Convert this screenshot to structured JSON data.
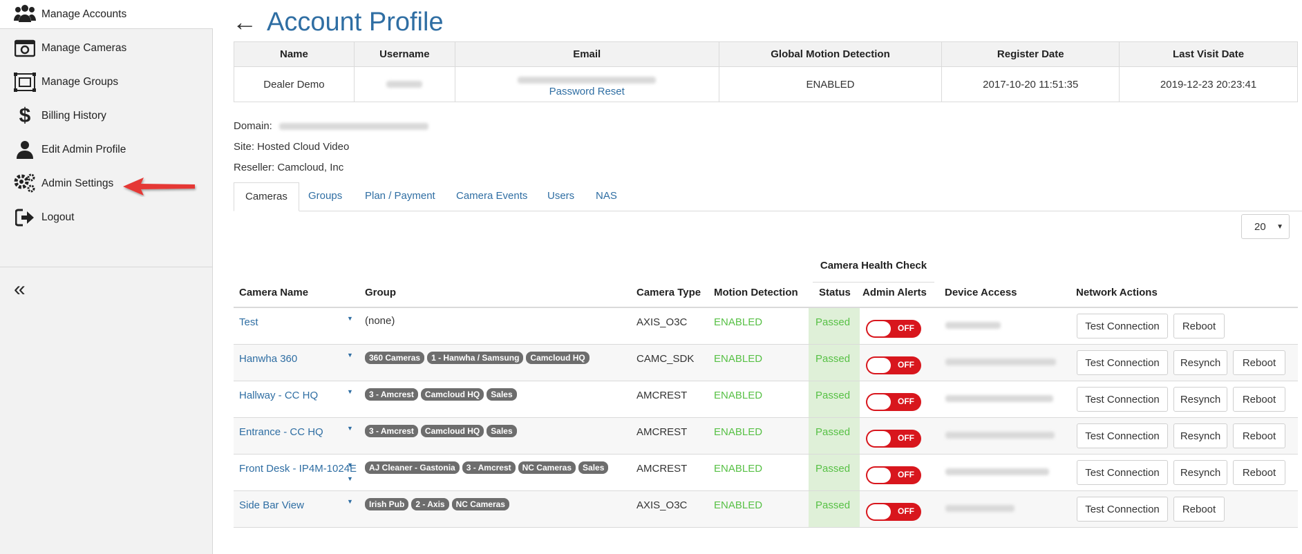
{
  "sidebar": {
    "items": [
      {
        "label": "Manage Accounts",
        "icon": "users-icon"
      },
      {
        "label": "Manage Cameras",
        "icon": "camera-icon"
      },
      {
        "label": "Manage Groups",
        "icon": "groups-icon"
      },
      {
        "label": "Billing History",
        "icon": "dollar-icon"
      },
      {
        "label": "Edit Admin Profile",
        "icon": "user-icon"
      },
      {
        "label": "Admin Settings",
        "icon": "gears-icon"
      },
      {
        "label": "Logout",
        "icon": "logout-icon"
      }
    ],
    "collapse_glyph": "«"
  },
  "page": {
    "back_glyph": "←",
    "title": "Account Profile"
  },
  "account": {
    "headers": [
      "Name",
      "Username",
      "Email",
      "Global Motion Detection",
      "Register Date",
      "Last Visit Date"
    ],
    "name": "Dealer Demo",
    "password_reset": "Password Reset",
    "motion": "ENABLED",
    "register_date": "2017-10-20 11:51:35",
    "last_visit": "2019-12-23 20:23:41"
  },
  "meta": {
    "domain_label": "Domain:",
    "site": "Site: Hosted Cloud Video",
    "reseller": "Reseller: Camcloud, Inc"
  },
  "tabs": [
    "Cameras",
    "Groups",
    "Plan / Payment",
    "Camera Events",
    "Users",
    "NAS"
  ],
  "page_size": "20",
  "cameras": {
    "health_check_header": "Camera Health Check",
    "headers": [
      "Camera Name",
      "Group",
      "Camera Type",
      "Motion Detection",
      "Status",
      "Admin Alerts",
      "Device Access",
      "Network Actions"
    ],
    "toggle_label": "OFF",
    "buttons": {
      "test": "Test Connection",
      "resynch": "Resynch",
      "reboot": "Reboot"
    },
    "rows": [
      {
        "name": "Test",
        "group_text": "(none)",
        "groups": [],
        "type": "AXIS_O3C",
        "motion": "ENABLED",
        "status": "Passed",
        "resynch": false
      },
      {
        "name": "Hanwha 360",
        "group_text": "",
        "groups": [
          "360 Cameras",
          "1 - Hanwha / Samsung",
          "Camcloud HQ"
        ],
        "type": "CAMC_SDK",
        "motion": "ENABLED",
        "status": "Passed",
        "resynch": true
      },
      {
        "name": "Hallway - CC HQ",
        "group_text": "",
        "groups": [
          "3 - Amcrest",
          "Camcloud HQ",
          "Sales"
        ],
        "type": "AMCREST",
        "motion": "ENABLED",
        "status": "Passed",
        "resynch": true
      },
      {
        "name": "Entrance - CC HQ",
        "group_text": "",
        "groups": [
          "3 - Amcrest",
          "Camcloud HQ",
          "Sales"
        ],
        "type": "AMCREST",
        "motion": "ENABLED",
        "status": "Passed",
        "resynch": true
      },
      {
        "name": "Front Desk - IP4M-1024E",
        "group_text": "",
        "groups": [
          "AJ Cleaner - Gastonia",
          "3 - Amcrest",
          "NC Cameras",
          "Sales"
        ],
        "type": "AMCREST",
        "motion": "ENABLED",
        "status": "Passed",
        "resynch": true
      },
      {
        "name": "Side Bar View",
        "group_text": "",
        "groups": [
          "Irish Pub",
          "2 - Axis",
          "NC Cameras"
        ],
        "type": "AXIS_O3C",
        "motion": "ENABLED",
        "status": "Passed",
        "resynch": false
      }
    ]
  }
}
